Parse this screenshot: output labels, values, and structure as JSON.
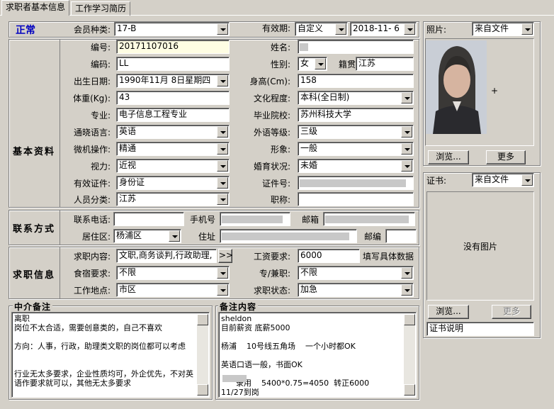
{
  "tabs": [
    "求职者基本信息",
    "工作学习简历"
  ],
  "status": "正常",
  "membership": {
    "label": "会员种类:",
    "value": "17-B"
  },
  "validity": {
    "label": "有效期:",
    "mode": "自定义",
    "date": "2018-11- 6"
  },
  "photo": {
    "label": "照片:",
    "source": "来自文件",
    "browse": "浏览...",
    "more": "更多"
  },
  "cert": {
    "label": "证书:",
    "source": "来自文件",
    "no_image": "没有图片",
    "browse": "浏览...",
    "more": "更多",
    "desc": "证书说明"
  },
  "basic": {
    "section": "基本资料",
    "id_label": "编号:",
    "id_value": "20171107016",
    "name_label": "姓名:",
    "code_label": "编码:",
    "code_value": "LL",
    "gender_label": "性别:",
    "gender_value": "女",
    "native_label": "籍贯",
    "native_value": "江苏",
    "birth_label": "出生日期:",
    "birth_value": "1990年11月 8日星期四",
    "height_label": "身高(Cm):",
    "height_value": "158",
    "weight_label": "体重(Kg):",
    "weight_value": "43",
    "edu_label": "文化程度:",
    "edu_value": "本科(全日制)",
    "major_label": "专业:",
    "major_value": "电子信息工程专业",
    "school_label": "毕业院校:",
    "school_value": "苏州科技大学",
    "lang_label": "通晓语言:",
    "lang_value": "英语",
    "langlevel_label": "外语等级:",
    "langlevel_value": "三级",
    "computer_label": "微机操作:",
    "computer_value": "精通",
    "appearance_label": "形象:",
    "appearance_value": "一般",
    "vision_label": "视力:",
    "vision_value": "近视",
    "marital_label": "婚育状况:",
    "marital_value": "未婚",
    "idtype_label": "有效证件:",
    "idtype_value": "身份证",
    "idno_label": "证件号:",
    "category_label": "人员分类:",
    "category_value": "江苏",
    "title_label": "职称:"
  },
  "contact": {
    "section": "联系方式",
    "phone_label": "联系电话:",
    "mobile_label": "手机号",
    "email_label": "邮箱",
    "district_label": "居住区:",
    "district_value": "杨浦区",
    "address_label": "住址",
    "zip_label": "邮编"
  },
  "job": {
    "section": "求职信息",
    "content_label": "求职内容:",
    "content_value": "文职,商务谈判,行政助理,",
    "expand": ">>",
    "salary_label": "工资要求:",
    "salary_value": "6000",
    "salary_hint": "填写具体数据",
    "board_label": "食宿要求:",
    "board_value": "不限",
    "type_label": "专/兼职:",
    "type_value": "不限",
    "location_label": "工作地点:",
    "location_value": "市区",
    "state_label": "求职状态:",
    "state_value": "加急"
  },
  "notes": {
    "agent_title": "中介备注",
    "agent_text": "离职\n岗位不太合适，需要创意类的，自己不喜欢\n\n方向：人事，行政，助理类文职的岗位都可以考虑\n\n\n行业无太多要求，企业性质均可，外企优先，不对英语作要求就可以，其他无太多要求",
    "remark_title": "备注内容",
    "remark_text": "sheldon\n目前薪资 底薪5000\n\n杨浦    10号线五角场    一个小时都OK\n\n英语口语一般，书面OK\n\n      录用    5400*0.75=4050  转正6000\n11/27到岗"
  }
}
